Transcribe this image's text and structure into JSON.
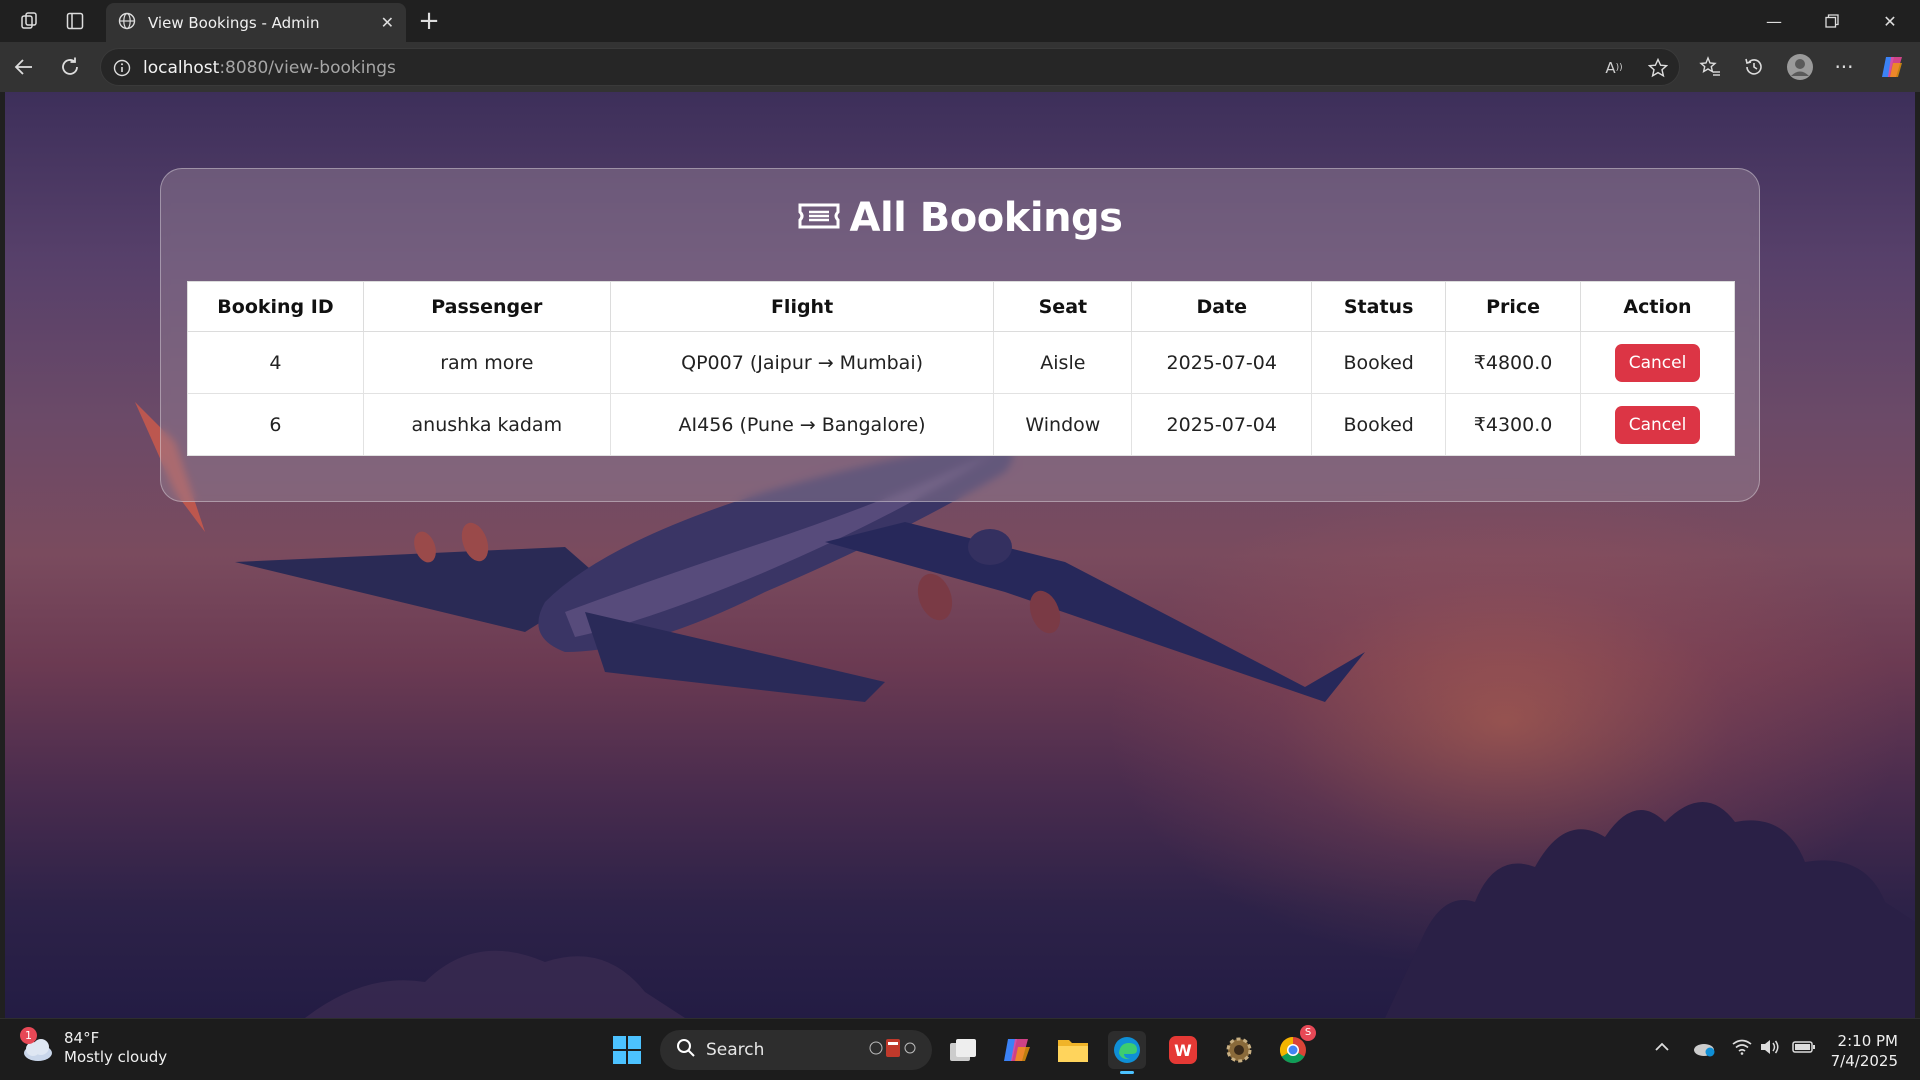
{
  "browser": {
    "tab_title": "View Bookings - Admin",
    "url_host": "localhost",
    "url_path": ":8080/view-bookings"
  },
  "page": {
    "heading": "All Bookings",
    "columns": [
      "Booking ID",
      "Passenger",
      "Flight",
      "Seat",
      "Date",
      "Status",
      "Price",
      "Action"
    ],
    "rows": [
      {
        "id": "4",
        "passenger": "ram more",
        "flight": "QP007 (Jaipur → Mumbai)",
        "seat": "Aisle",
        "date": "2025-07-04",
        "status": "Booked",
        "price": "₹4800.0",
        "action": "Cancel"
      },
      {
        "id": "6",
        "passenger": "anushka kadam",
        "flight": "AI456 (Pune → Bangalore)",
        "seat": "Window",
        "date": "2025-07-04",
        "status": "Booked",
        "price": "₹4300.0",
        "action": "Cancel"
      }
    ]
  },
  "taskbar": {
    "weather_badge": "1",
    "temperature": "84°F",
    "condition": "Mostly cloudy",
    "search_label": "Search",
    "chrome_badge": "S",
    "time": "2:10 PM",
    "date": "7/4/2025"
  },
  "colors": {
    "cancel_button": "#dc3545",
    "card_background": "rgba(150,130,150,0.45)",
    "chrome_background": "#202020"
  }
}
